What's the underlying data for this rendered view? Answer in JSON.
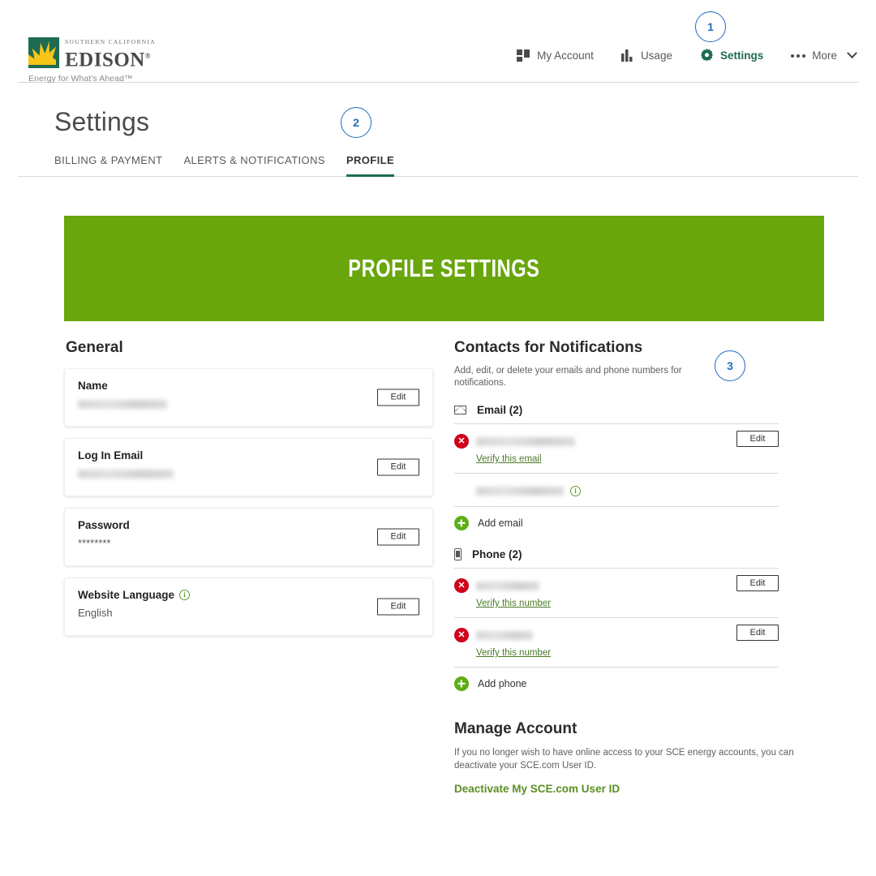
{
  "brand": {
    "logo_superline": "SOUTHERN CALIFORNIA",
    "logo_name": "EDISON",
    "logo_tagline": "Energy for What's Ahead™"
  },
  "topnav": {
    "items": [
      {
        "label": "My Account",
        "icon": "dashboard-icon",
        "active": false
      },
      {
        "label": "Usage",
        "icon": "bar-chart-icon",
        "active": false
      },
      {
        "label": "Settings",
        "icon": "gear-icon",
        "active": true
      },
      {
        "label": "More",
        "icon": "ellipsis-icon",
        "active": false
      }
    ]
  },
  "badges": [
    {
      "id": "1",
      "label": "1"
    },
    {
      "id": "2",
      "label": "2"
    },
    {
      "id": "3",
      "label": "3"
    }
  ],
  "page": {
    "title": "Settings",
    "tabs": [
      {
        "label": "BILLING & PAYMENT",
        "active": false
      },
      {
        "label": "ALERTS & NOTIFICATIONS",
        "active": false
      },
      {
        "label": "PROFILE",
        "active": true
      }
    ],
    "banner_title": "PROFILE SETTINGS",
    "banner_color": "#68a60b",
    "accent_green": "#1e6b52"
  },
  "general": {
    "heading": "General",
    "edit_label": "Edit",
    "cards": [
      {
        "label": "Name",
        "value": "",
        "redacted": true,
        "redacted_width": 110,
        "info": false
      },
      {
        "label": "Log In Email",
        "value": "",
        "redacted": true,
        "redacted_width": 118,
        "info": false
      },
      {
        "label": "Password",
        "value": "********",
        "redacted": false,
        "info": false
      },
      {
        "label": "Website Language",
        "value": "English",
        "redacted": false,
        "info": true
      }
    ]
  },
  "contacts": {
    "heading": "Contacts for Notifications",
    "description": "Add, edit, or delete your emails and phone numbers for notifications.",
    "edit_label": "Edit",
    "email_group": {
      "icon": "envelope-icon",
      "label": "Email (2)",
      "rows": [
        {
          "value": "",
          "redacted": true,
          "redacted_width": 122,
          "unverified": true,
          "verify_label": "Verify this email",
          "has_edit": true,
          "info": false
        },
        {
          "value": "",
          "redacted": true,
          "redacted_width": 108,
          "unverified": false,
          "verify_label": "",
          "has_edit": false,
          "info": true
        }
      ],
      "add_label": "Add email"
    },
    "phone_group": {
      "icon": "phone-icon",
      "label": "Phone (2)",
      "rows": [
        {
          "value": "",
          "redacted": true,
          "redacted_width": 78,
          "unverified": true,
          "verify_label": "Verify this number",
          "has_edit": true,
          "info": false
        },
        {
          "value": "",
          "redacted": true,
          "redacted_width": 70,
          "unverified": true,
          "verify_label": "Verify this number",
          "has_edit": true,
          "info": false
        }
      ],
      "add_label": "Add phone"
    }
  },
  "manage_account": {
    "heading": "Manage Account",
    "description": "If you no longer wish to have online access to your SCE energy accounts, you can deactivate your SCE.com User ID.",
    "link_label": "Deactivate My SCE.com User ID"
  }
}
